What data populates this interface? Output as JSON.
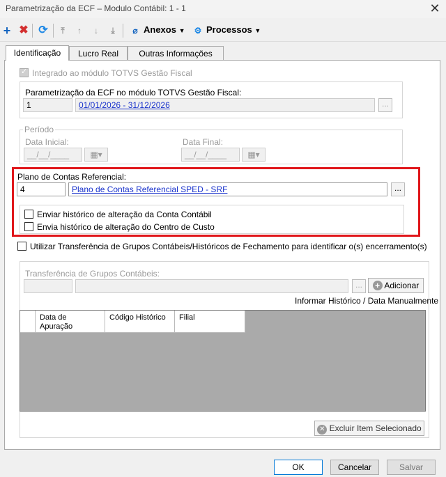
{
  "window": {
    "title": "Parametrização da ECF – Modulo Contábil: 1 - 1"
  },
  "toolbar": {
    "anexos_label": "Anexos",
    "processos_label": "Processos"
  },
  "tabs": [
    "Identificação",
    "Lucro Real",
    "Outras Informações"
  ],
  "integrado": {
    "label": "Integrado ao módulo TOTVS Gestão Fiscal",
    "checked": true
  },
  "parametrizacao": {
    "label": "Parametrização da ECF no módulo TOTVS Gestão Fiscal:",
    "code": "1",
    "period": "01/01/2026 - 31/12/2026"
  },
  "periodo": {
    "label": "Período",
    "data_inicial_label": "Data Inicial:",
    "data_final_label": "Data Final:",
    "date_mask": "__/__/____"
  },
  "plano": {
    "label": "Plano de Contas Referencial:",
    "code": "4",
    "name": "Plano de Contas Referencial SPED - SRF"
  },
  "checks": {
    "historico_conta": "Enviar histórico de alteração da Conta Contábil",
    "historico_centro": "Envia histórico de alteração do Centro de Custo",
    "transferencia": "Utilizar Transferência de Grupos Contábeis/Históricos de Fechamento para identificar o(s) encerramento(s)"
  },
  "transferencia": {
    "label": "Transferência de Grupos Contábeis:",
    "adicionar_label": "Adicionar",
    "informar_label": "Informar Histórico / Data Manualmente"
  },
  "grid": {
    "columns": [
      "Data de Apuração",
      "Código Histórico",
      "Filial"
    ]
  },
  "excluir_label": "Excluir Item Selecionado",
  "footer": {
    "ok": "OK",
    "cancelar": "Cancelar",
    "salvar": "Salvar"
  },
  "dots": "..."
}
